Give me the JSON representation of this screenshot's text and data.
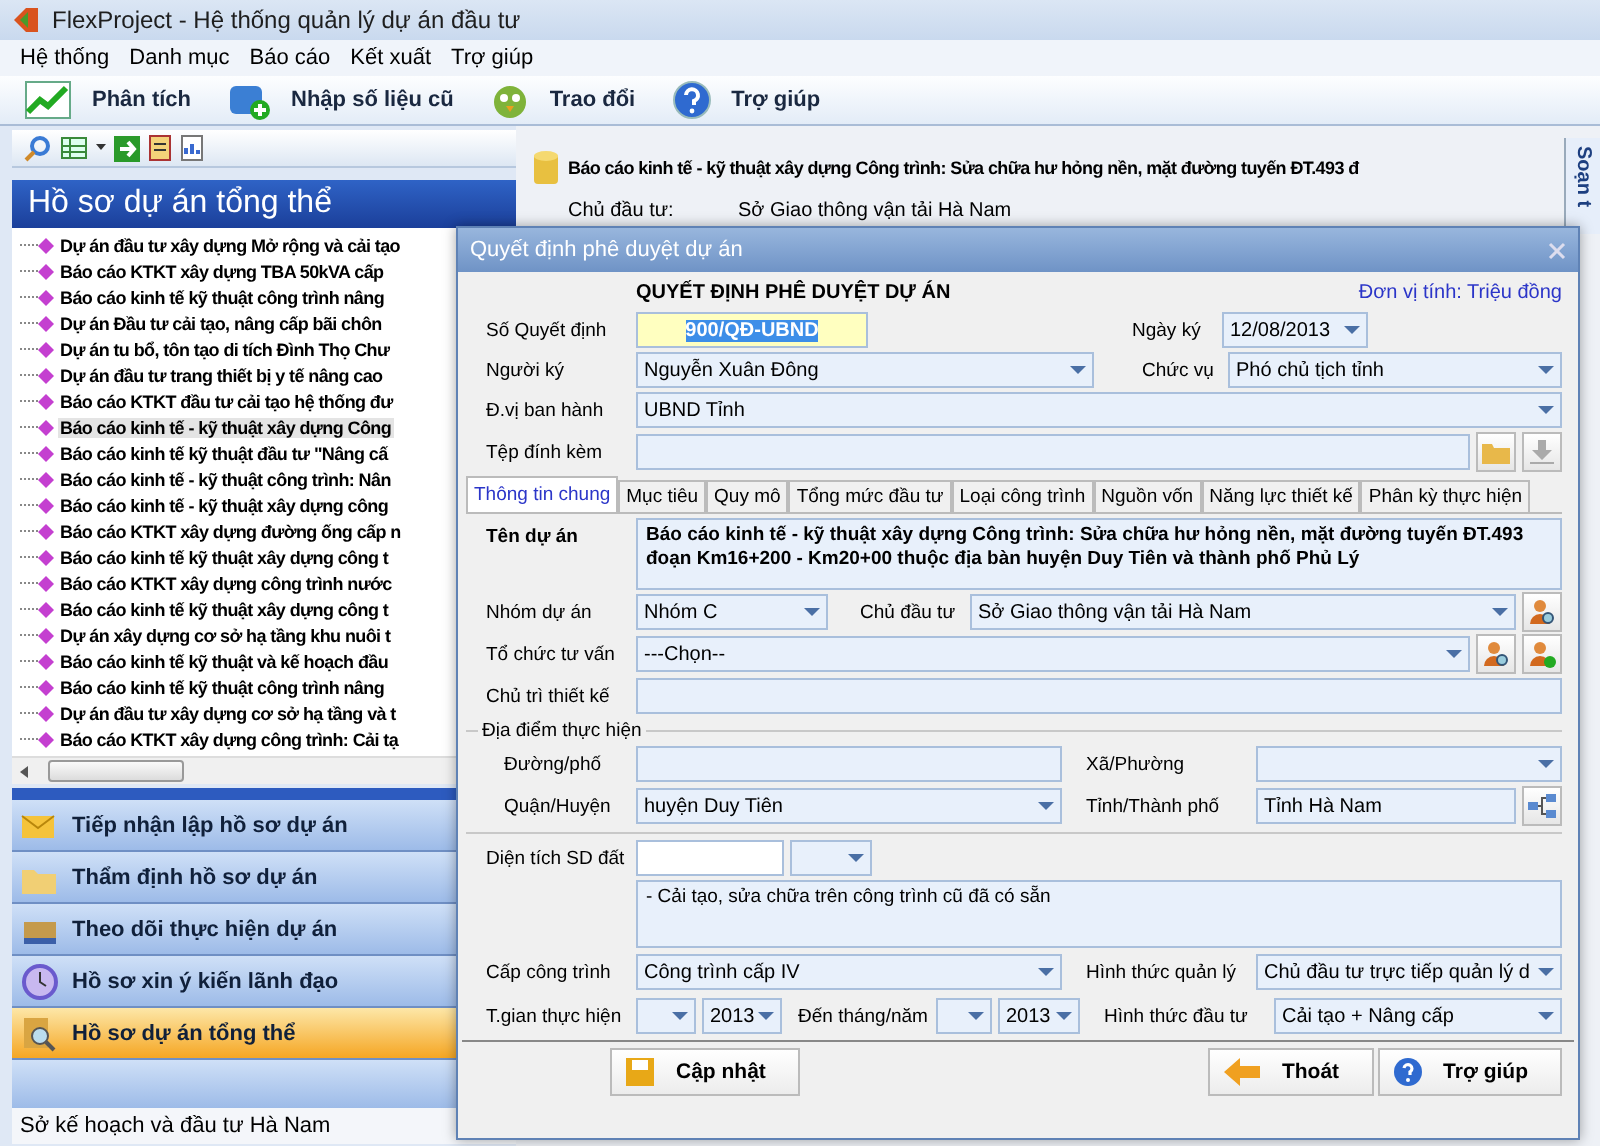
{
  "window": {
    "title": "FlexProject - Hệ thống quản lý dự án đầu tư"
  },
  "menu": [
    "Hệ thống",
    "Danh mục",
    "Báo cáo",
    "Kết xuất",
    "Trợ giúp"
  ],
  "toolbar": [
    {
      "label": "Phân tích",
      "kind": "chart"
    },
    {
      "label": "Nhập số liệu cũ",
      "kind": "import"
    },
    {
      "label": "Trao đổi",
      "kind": "bird"
    },
    {
      "label": "Trợ giúp",
      "kind": "help"
    }
  ],
  "left_panel": {
    "header": "Hồ sơ dự án tổng thể",
    "tree": [
      {
        "label": "Dự án đầu tư xây dựng Mở rộng và cải tạo",
        "selected": false
      },
      {
        "label": "Báo cáo KTKT xây dựng TBA 50kVA cấp",
        "selected": false
      },
      {
        "label": "Báo cáo kinh tế kỹ thuật công trình nâng",
        "selected": false
      },
      {
        "label": "Dự án Đầu tư cải tạo, nâng cấp bãi chôn",
        "selected": false
      },
      {
        "label": "Dự án tu bổ, tôn tạo di tích Đình Thọ Chư",
        "selected": false
      },
      {
        "label": "Dự án đầu tư trang thiết bị y tế nâng cao",
        "selected": false
      },
      {
        "label": "Báo cáo KTKT đầu tư cải tạo hệ thống đư",
        "selected": false
      },
      {
        "label": "Báo cáo kinh tế - kỹ thuật xây dựng Công",
        "selected": true
      },
      {
        "label": "Báo cáo kinh tế kỹ thuật đầu tư \"Nâng cấ",
        "selected": false
      },
      {
        "label": "Báo cáo kinh tế - kỹ thuật công trình: Nân",
        "selected": false
      },
      {
        "label": "Báo cáo kinh tế - kỹ thuật xây dựng công",
        "selected": false
      },
      {
        "label": "Báo cáo KTKT xây dựng đường ống cấp n",
        "selected": false
      },
      {
        "label": "Báo cáo kinh tế kỹ thuật xây dựng công t",
        "selected": false
      },
      {
        "label": "Báo cáo KTKT xây dựng công trình nước",
        "selected": false
      },
      {
        "label": "Báo cáo kinh tế kỹ thuật xây dựng công t",
        "selected": false
      },
      {
        "label": "Dự án xây dựng cơ sở hạ tầng khu nuôi t",
        "selected": false
      },
      {
        "label": "Báo cáo kinh tế kỹ thuật và kế hoạch đầu",
        "selected": false
      },
      {
        "label": "Báo cáo kinh tế kỹ thuật công trình nâng",
        "selected": false
      },
      {
        "label": "Dự án đầu tư xây dựng cơ sở hạ tầng và t",
        "selected": false
      },
      {
        "label": "Báo cáo KTKT xây dựng công trình: Cải tạ",
        "selected": false
      }
    ],
    "nav": [
      {
        "label": "Tiếp nhận lập hồ sơ dự án",
        "kind": "inbox",
        "selected": false
      },
      {
        "label": "Thẩm định hồ sơ dự án",
        "kind": "folder",
        "selected": false
      },
      {
        "label": "Theo dõi thực hiện dự án",
        "kind": "box",
        "selected": false
      },
      {
        "label": "Hồ sơ xin ý kiến lãnh đạo",
        "kind": "clock",
        "selected": false
      },
      {
        "label": "Hồ sơ dự án tổng thể",
        "kind": "search",
        "selected": true
      }
    ],
    "status": "Sở kế hoạch và đầu tư Hà Nam"
  },
  "project_summary": {
    "title": "Báo cáo kinh tế - kỹ thuật xây dựng Công trình: Sửa chữa hư hỏng nền, mặt đường tuyến ĐT.493 đ",
    "rows": [
      {
        "label": "Chủ đầu tư:",
        "value": "Sở Giao thông vận tải Hà Nam"
      }
    ],
    "side_tab": "Soạn t"
  },
  "dialog": {
    "title": "Quyết định phê duyệt dự án",
    "heading": "QUYẾT ĐỊNH PHÊ DUYỆT DỰ ÁN",
    "unit": "Đơn vị tính: Triệu đồng",
    "decision_no": {
      "label": "Số Quyết định",
      "value": "900/QĐ-UBND",
      "highlighted": true
    },
    "sign_date": {
      "label": "Ngày ký",
      "value": "12/08/2013"
    },
    "signer": {
      "label": "Người ký",
      "value": "Nguyễn Xuân Đông"
    },
    "position": {
      "label": "Chức vụ",
      "value": "Phó chủ tịch tỉnh"
    },
    "issuer": {
      "label": "Đ.vị ban hành",
      "value": "UBND Tỉnh"
    },
    "attachment": {
      "label": "Tệp đính kèm"
    },
    "tabs": [
      {
        "label": "Thông tin chung",
        "selected": true
      },
      {
        "label": "Mục tiêu",
        "selected": false
      },
      {
        "label": "Quy mô",
        "selected": false
      },
      {
        "label": "Tổng mức đầu tư",
        "selected": false
      },
      {
        "label": "Loại công trình",
        "selected": false
      },
      {
        "label": "Nguồn vốn",
        "selected": false
      },
      {
        "label": "Năng lực thiết kế",
        "selected": false
      },
      {
        "label": "Phân kỳ thực hiện",
        "selected": false
      }
    ],
    "project_name": {
      "label": "Tên dự án",
      "value": "Báo cáo kinh tế - kỹ thuật xây dựng Công trình: Sửa chữa hư hỏng nền, mặt đường tuyến ĐT.493 đoạn Km16+200 - Km20+00 thuộc địa bàn huyện Duy Tiên và thành phố Phủ Lý"
    },
    "group": {
      "label": "Nhóm dự án",
      "value": "Nhóm C"
    },
    "investor": {
      "label": "Chủ đầu tư",
      "value": "Sở Giao thông vận tải Hà Nam"
    },
    "consultant": {
      "label": "Tổ chức tư vấn",
      "value": "---Chọn--"
    },
    "design_lead": {
      "label": "Chủ trì thiết kế"
    },
    "location": {
      "legend": "Địa điểm thực hiện",
      "street": {
        "label": "Đường/phố"
      },
      "ward": {
        "label": "Xã/Phường"
      },
      "district": {
        "label": "Quận/Huyện",
        "value": "huyện Duy Tiên"
      },
      "province": {
        "label": "Tỉnh/Thành phố",
        "value": "Tỉnh Hà Nam"
      }
    },
    "land_area": {
      "label": "Diện tích SD đất"
    },
    "description": "- Cải tạo, sửa chữa trên công trình cũ đã có sẵn",
    "grade": {
      "label": "Cấp công trình",
      "value": "Công trình cấp IV"
    },
    "management": {
      "label": "Hình thức quản lý",
      "value": "Chủ đầu tư trực tiếp quản lý d"
    },
    "period": {
      "label": "T.gian thực hiện",
      "year": "2013"
    },
    "period_end": {
      "label": "Đến tháng/năm",
      "year": "2013"
    },
    "investment_form": {
      "label": "Hình thức đầu tư",
      "value": "Cải tạo + Nâng cấp"
    },
    "buttons": [
      {
        "label": "Cập nhật",
        "kind": "save"
      },
      {
        "label": "Thoát",
        "kind": "exit"
      },
      {
        "label": "Trợ giúp",
        "kind": "help"
      }
    ]
  }
}
